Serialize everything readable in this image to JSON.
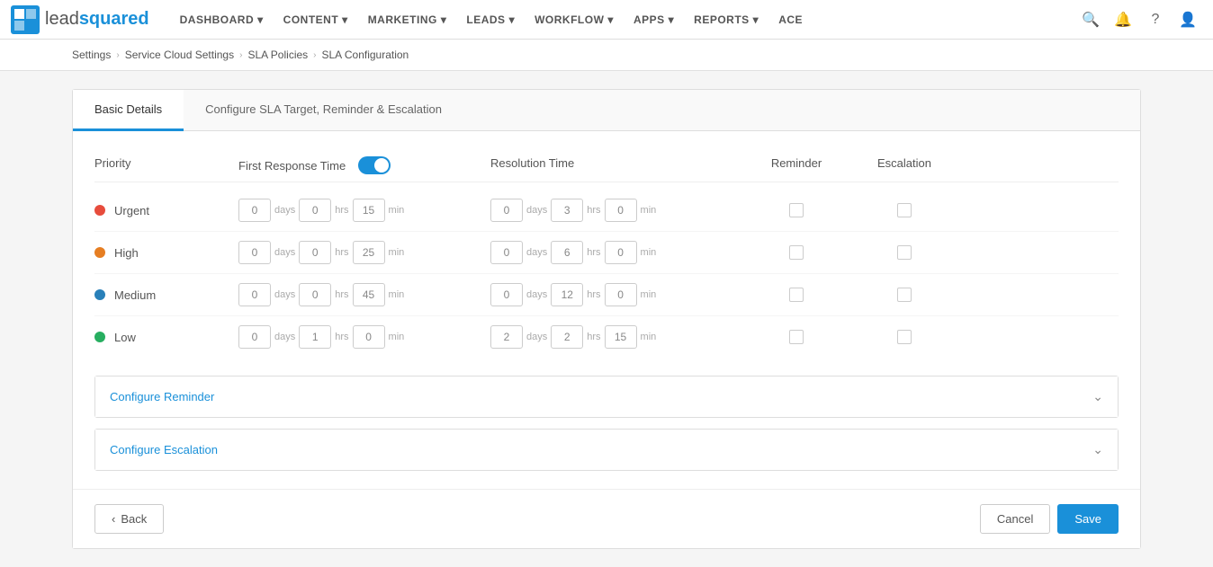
{
  "logo": {
    "lead": "lead",
    "squared": "squared"
  },
  "nav": {
    "items": [
      {
        "label": "DASHBOARD",
        "id": "dashboard"
      },
      {
        "label": "CONTENT",
        "id": "content"
      },
      {
        "label": "MARKETING",
        "id": "marketing"
      },
      {
        "label": "LEADS",
        "id": "leads"
      },
      {
        "label": "WORKFLOW",
        "id": "workflow"
      },
      {
        "label": "APPS",
        "id": "apps"
      },
      {
        "label": "REPORTS",
        "id": "reports"
      },
      {
        "label": "ACE",
        "id": "ace"
      }
    ]
  },
  "breadcrumb": {
    "items": [
      "Settings",
      "Service Cloud Settings",
      "SLA Policies",
      "SLA Configuration"
    ]
  },
  "tabs": {
    "items": [
      {
        "label": "Basic Details",
        "active": true
      },
      {
        "label": "Configure SLA Target, Reminder & Escalation",
        "active": false
      }
    ]
  },
  "table": {
    "headers": {
      "priority": "Priority",
      "first_response_time": "First Response Time",
      "resolution_time": "Resolution Time",
      "reminder": "Reminder",
      "escalation": "Escalation"
    },
    "rows": [
      {
        "priority": "Urgent",
        "color": "#e74c3c",
        "frt": {
          "days": "0",
          "hrs": "0",
          "min": "15"
        },
        "rt": {
          "days": "0",
          "hrs": "3",
          "min": "0"
        }
      },
      {
        "priority": "High",
        "color": "#e67e22",
        "frt": {
          "days": "0",
          "hrs": "0",
          "min": "25"
        },
        "rt": {
          "days": "0",
          "hrs": "6",
          "min": "0"
        }
      },
      {
        "priority": "Medium",
        "color": "#2980b9",
        "frt": {
          "days": "0",
          "hrs": "0",
          "min": "45"
        },
        "rt": {
          "days": "0",
          "hrs": "12",
          "min": "0"
        }
      },
      {
        "priority": "Low",
        "color": "#27ae60",
        "frt": {
          "days": "0",
          "hrs": "1",
          "min": "0"
        },
        "rt": {
          "days": "2",
          "hrs": "2",
          "min": "15"
        }
      }
    ]
  },
  "accordion": {
    "configure_reminder": "Configure Reminder",
    "configure_escalation": "Configure Escalation"
  },
  "buttons": {
    "back": "Back",
    "cancel": "Cancel",
    "save": "Save"
  },
  "labels": {
    "days": "days",
    "hrs": "hrs",
    "min": "min"
  }
}
